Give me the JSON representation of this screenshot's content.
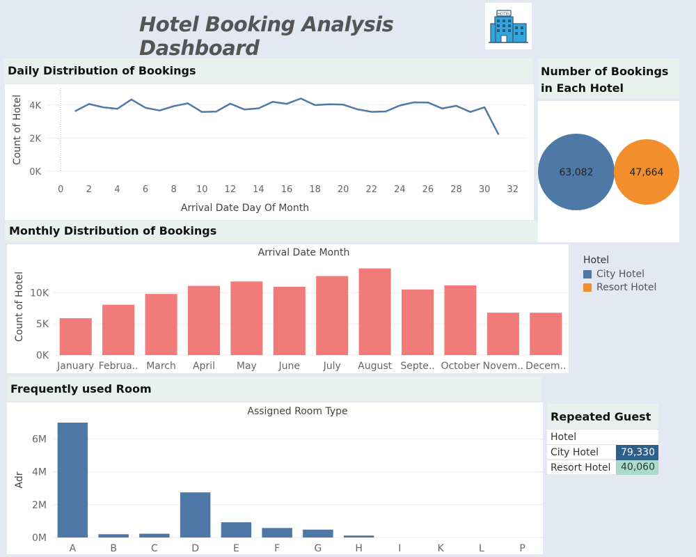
{
  "dashboard": {
    "title": "Hotel Booking Analysis Dashboard",
    "logo_icon": "hotel-building-icon",
    "logo_sign": "HOTEL"
  },
  "colors": {
    "city": "#4e79a7",
    "resort": "#f28e2b",
    "monthly_bar": "#f07b79",
    "line": "#4e79a7",
    "room_bar": "#4e79a7",
    "city_cell": "#2d5f8b",
    "resort_cell": "#a8dcc8"
  },
  "daily": {
    "header": "Daily Distribution of Bookings"
  },
  "monthly": {
    "header": "Monthly Distribution of Bookings"
  },
  "room": {
    "header": "Frequently used Room"
  },
  "hotels_panel": {
    "header_line1": "Number of Bookings",
    "header_line2": "in Each Hotel",
    "city_value": "63,082",
    "resort_value": "47,664"
  },
  "legend": {
    "title": "Hotel",
    "items": [
      {
        "label": "City Hotel",
        "color": "#4e79a7"
      },
      {
        "label": "Resort Hotel",
        "color": "#f28e2b"
      }
    ]
  },
  "repeated": {
    "header": "Repeated Guest",
    "column": "Hotel",
    "rows": [
      {
        "label": "City Hotel",
        "value": "79,330"
      },
      {
        "label": "Resort Hotel",
        "value": "40,060"
      }
    ]
  },
  "chart_data": [
    {
      "type": "line",
      "title": "",
      "xlabel": "Arrival Date Day Of Month",
      "ylabel": "Count of Hotel",
      "x": [
        1,
        2,
        3,
        4,
        5,
        6,
        7,
        8,
        9,
        10,
        11,
        12,
        13,
        14,
        15,
        16,
        17,
        18,
        19,
        20,
        21,
        22,
        23,
        24,
        25,
        26,
        27,
        28,
        29,
        30,
        31
      ],
      "values": [
        3620,
        4060,
        3860,
        3770,
        4330,
        3830,
        3670,
        3930,
        4100,
        3580,
        3600,
        4080,
        3730,
        3800,
        4190,
        4070,
        4390,
        3990,
        4040,
        4020,
        3740,
        3590,
        3610,
        3970,
        4160,
        4150,
        3790,
        3950,
        3580,
        3860,
        2210
      ],
      "xticks": [
        0,
        2,
        4,
        6,
        8,
        10,
        12,
        14,
        16,
        18,
        20,
        22,
        24,
        26,
        28,
        30,
        32
      ],
      "yticks": [
        {
          "v": 0,
          "label": "0K"
        },
        {
          "v": 2000,
          "label": "2K"
        },
        {
          "v": 4000,
          "label": "4K"
        }
      ],
      "xlim": [
        -1,
        33
      ],
      "ylim": [
        0,
        5000
      ]
    },
    {
      "type": "bar",
      "title": "Arrival Date Month",
      "ylabel": "Count of Hotel",
      "categories": [
        "January",
        "Februa..",
        "March",
        "April",
        "May",
        "June",
        "July",
        "August",
        "Septe..",
        "October",
        "Novem..",
        "Decem.."
      ],
      "values": [
        5900,
        8070,
        9790,
        11090,
        11790,
        10940,
        12660,
        13880,
        10510,
        11160,
        6790,
        6780
      ],
      "yticks": [
        {
          "v": 0,
          "label": "0K"
        },
        {
          "v": 5000,
          "label": "5K"
        },
        {
          "v": 10000,
          "label": "10K"
        }
      ],
      "ylim": [
        0,
        15500
      ]
    },
    {
      "type": "bar",
      "title": "Assigned Room Type",
      "ylabel": "Adr",
      "categories": [
        "A",
        "B",
        "C",
        "D",
        "E",
        "F",
        "G",
        "H",
        "I",
        "K",
        "L",
        "P"
      ],
      "values": [
        7000000,
        200000,
        230000,
        2750000,
        930000,
        580000,
        480000,
        120000,
        0,
        0,
        0,
        0
      ],
      "yticks": [
        {
          "v": 0,
          "label": "0M"
        },
        {
          "v": 2000000,
          "label": "2M"
        },
        {
          "v": 4000000,
          "label": "4M"
        },
        {
          "v": 6000000,
          "label": "6M"
        }
      ],
      "ylim": [
        0,
        7000000
      ]
    }
  ]
}
